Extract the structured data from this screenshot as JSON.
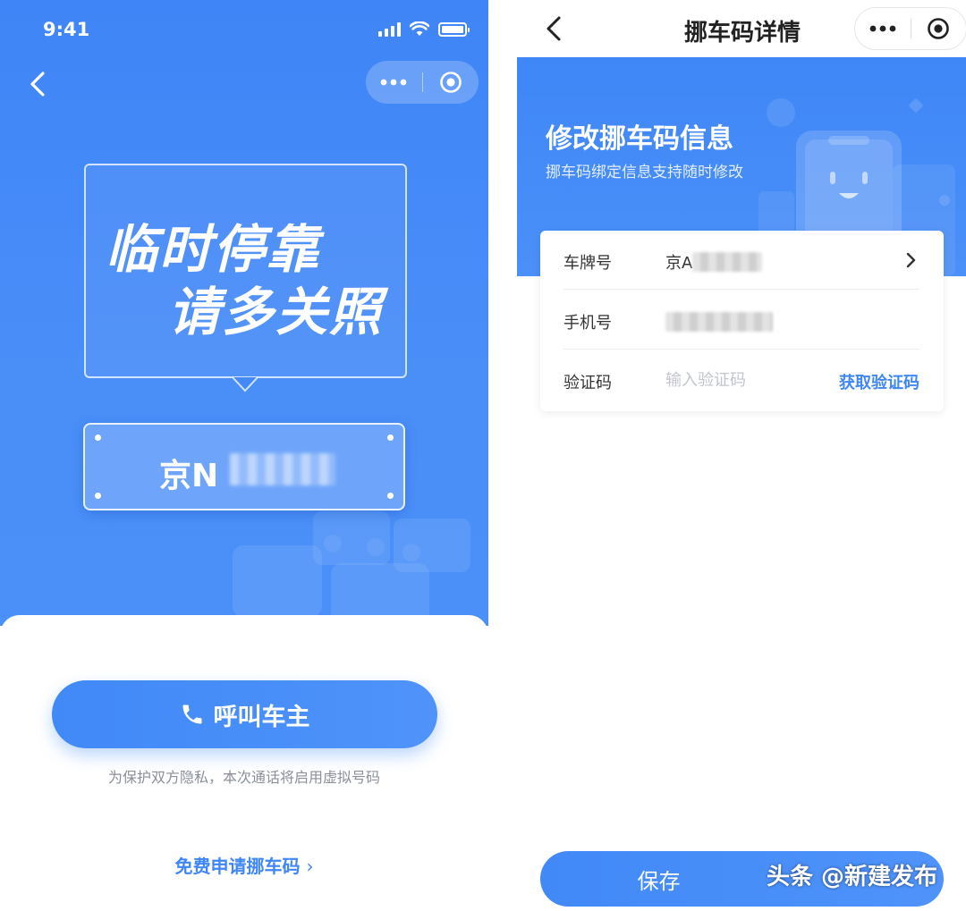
{
  "status_bar": {
    "time": "9:41"
  },
  "left": {
    "slogan_line1": "临时停靠",
    "slogan_line2": "请多关照",
    "plate_prefix": "京N",
    "call_button": "呼叫车主",
    "privacy_note": "为保护双方隐私，本次通话将启用虚拟号码",
    "apply_link": "免费申请挪车码",
    "apply_link_chevron": "›"
  },
  "right": {
    "title": "挪车码详情",
    "banner_title": "修改挪车码信息",
    "banner_subtitle": "挪车码绑定信息支持随时修改",
    "rows": [
      {
        "label": "车牌号",
        "value": "京A"
      },
      {
        "label": "手机号",
        "value": ""
      },
      {
        "label": "验证码",
        "placeholder": "输入验证码",
        "action": "获取验证码"
      }
    ],
    "save_button": "保存",
    "watermark": "头条 @新建发布"
  },
  "colors": {
    "brand_blue": "#3f86f6",
    "white": "#ffffff"
  },
  "icons": [
    "back-icon",
    "more-dots-icon",
    "target-circle-icon",
    "phone-icon",
    "chevron-right-icon",
    "signal-icon",
    "wifi-icon",
    "battery-icon"
  ]
}
